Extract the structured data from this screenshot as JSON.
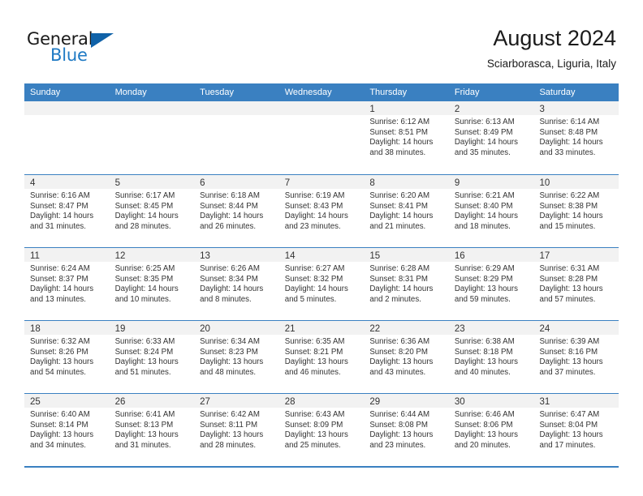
{
  "brand": {
    "name_top": "General",
    "name_bottom": "Blue",
    "flag_icon": "blue-triangle-flag-icon",
    "color_primary": "#1062a8",
    "color_text": "#1f7ac4"
  },
  "header": {
    "title": "August 2024",
    "subtitle": "Sciarborasca, Liguria, Italy"
  },
  "theme": {
    "header_bar": "#3a80c1",
    "daynum_strip": "#f2f2f2",
    "text": "#333333"
  },
  "calendar": {
    "day_names": [
      "Sunday",
      "Monday",
      "Tuesday",
      "Wednesday",
      "Thursday",
      "Friday",
      "Saturday"
    ],
    "weeks": [
      [
        {
          "day": "",
          "lines": []
        },
        {
          "day": "",
          "lines": []
        },
        {
          "day": "",
          "lines": []
        },
        {
          "day": "",
          "lines": []
        },
        {
          "day": "1",
          "lines": [
            "Sunrise: 6:12 AM",
            "Sunset: 8:51 PM",
            "Daylight: 14 hours",
            "and 38 minutes."
          ]
        },
        {
          "day": "2",
          "lines": [
            "Sunrise: 6:13 AM",
            "Sunset: 8:49 PM",
            "Daylight: 14 hours",
            "and 35 minutes."
          ]
        },
        {
          "day": "3",
          "lines": [
            "Sunrise: 6:14 AM",
            "Sunset: 8:48 PM",
            "Daylight: 14 hours",
            "and 33 minutes."
          ]
        }
      ],
      [
        {
          "day": "4",
          "lines": [
            "Sunrise: 6:16 AM",
            "Sunset: 8:47 PM",
            "Daylight: 14 hours",
            "and 31 minutes."
          ]
        },
        {
          "day": "5",
          "lines": [
            "Sunrise: 6:17 AM",
            "Sunset: 8:45 PM",
            "Daylight: 14 hours",
            "and 28 minutes."
          ]
        },
        {
          "day": "6",
          "lines": [
            "Sunrise: 6:18 AM",
            "Sunset: 8:44 PM",
            "Daylight: 14 hours",
            "and 26 minutes."
          ]
        },
        {
          "day": "7",
          "lines": [
            "Sunrise: 6:19 AM",
            "Sunset: 8:43 PM",
            "Daylight: 14 hours",
            "and 23 minutes."
          ]
        },
        {
          "day": "8",
          "lines": [
            "Sunrise: 6:20 AM",
            "Sunset: 8:41 PM",
            "Daylight: 14 hours",
            "and 21 minutes."
          ]
        },
        {
          "day": "9",
          "lines": [
            "Sunrise: 6:21 AM",
            "Sunset: 8:40 PM",
            "Daylight: 14 hours",
            "and 18 minutes."
          ]
        },
        {
          "day": "10",
          "lines": [
            "Sunrise: 6:22 AM",
            "Sunset: 8:38 PM",
            "Daylight: 14 hours",
            "and 15 minutes."
          ]
        }
      ],
      [
        {
          "day": "11",
          "lines": [
            "Sunrise: 6:24 AM",
            "Sunset: 8:37 PM",
            "Daylight: 14 hours",
            "and 13 minutes."
          ]
        },
        {
          "day": "12",
          "lines": [
            "Sunrise: 6:25 AM",
            "Sunset: 8:35 PM",
            "Daylight: 14 hours",
            "and 10 minutes."
          ]
        },
        {
          "day": "13",
          "lines": [
            "Sunrise: 6:26 AM",
            "Sunset: 8:34 PM",
            "Daylight: 14 hours",
            "and 8 minutes."
          ]
        },
        {
          "day": "14",
          "lines": [
            "Sunrise: 6:27 AM",
            "Sunset: 8:32 PM",
            "Daylight: 14 hours",
            "and 5 minutes."
          ]
        },
        {
          "day": "15",
          "lines": [
            "Sunrise: 6:28 AM",
            "Sunset: 8:31 PM",
            "Daylight: 14 hours",
            "and 2 minutes."
          ]
        },
        {
          "day": "16",
          "lines": [
            "Sunrise: 6:29 AM",
            "Sunset: 8:29 PM",
            "Daylight: 13 hours",
            "and 59 minutes."
          ]
        },
        {
          "day": "17",
          "lines": [
            "Sunrise: 6:31 AM",
            "Sunset: 8:28 PM",
            "Daylight: 13 hours",
            "and 57 minutes."
          ]
        }
      ],
      [
        {
          "day": "18",
          "lines": [
            "Sunrise: 6:32 AM",
            "Sunset: 8:26 PM",
            "Daylight: 13 hours",
            "and 54 minutes."
          ]
        },
        {
          "day": "19",
          "lines": [
            "Sunrise: 6:33 AM",
            "Sunset: 8:24 PM",
            "Daylight: 13 hours",
            "and 51 minutes."
          ]
        },
        {
          "day": "20",
          "lines": [
            "Sunrise: 6:34 AM",
            "Sunset: 8:23 PM",
            "Daylight: 13 hours",
            "and 48 minutes."
          ]
        },
        {
          "day": "21",
          "lines": [
            "Sunrise: 6:35 AM",
            "Sunset: 8:21 PM",
            "Daylight: 13 hours",
            "and 46 minutes."
          ]
        },
        {
          "day": "22",
          "lines": [
            "Sunrise: 6:36 AM",
            "Sunset: 8:20 PM",
            "Daylight: 13 hours",
            "and 43 minutes."
          ]
        },
        {
          "day": "23",
          "lines": [
            "Sunrise: 6:38 AM",
            "Sunset: 8:18 PM",
            "Daylight: 13 hours",
            "and 40 minutes."
          ]
        },
        {
          "day": "24",
          "lines": [
            "Sunrise: 6:39 AM",
            "Sunset: 8:16 PM",
            "Daylight: 13 hours",
            "and 37 minutes."
          ]
        }
      ],
      [
        {
          "day": "25",
          "lines": [
            "Sunrise: 6:40 AM",
            "Sunset: 8:14 PM",
            "Daylight: 13 hours",
            "and 34 minutes."
          ]
        },
        {
          "day": "26",
          "lines": [
            "Sunrise: 6:41 AM",
            "Sunset: 8:13 PM",
            "Daylight: 13 hours",
            "and 31 minutes."
          ]
        },
        {
          "day": "27",
          "lines": [
            "Sunrise: 6:42 AM",
            "Sunset: 8:11 PM",
            "Daylight: 13 hours",
            "and 28 minutes."
          ]
        },
        {
          "day": "28",
          "lines": [
            "Sunrise: 6:43 AM",
            "Sunset: 8:09 PM",
            "Daylight: 13 hours",
            "and 25 minutes."
          ]
        },
        {
          "day": "29",
          "lines": [
            "Sunrise: 6:44 AM",
            "Sunset: 8:08 PM",
            "Daylight: 13 hours",
            "and 23 minutes."
          ]
        },
        {
          "day": "30",
          "lines": [
            "Sunrise: 6:46 AM",
            "Sunset: 8:06 PM",
            "Daylight: 13 hours",
            "and 20 minutes."
          ]
        },
        {
          "day": "31",
          "lines": [
            "Sunrise: 6:47 AM",
            "Sunset: 8:04 PM",
            "Daylight: 13 hours",
            "and 17 minutes."
          ]
        }
      ]
    ]
  }
}
